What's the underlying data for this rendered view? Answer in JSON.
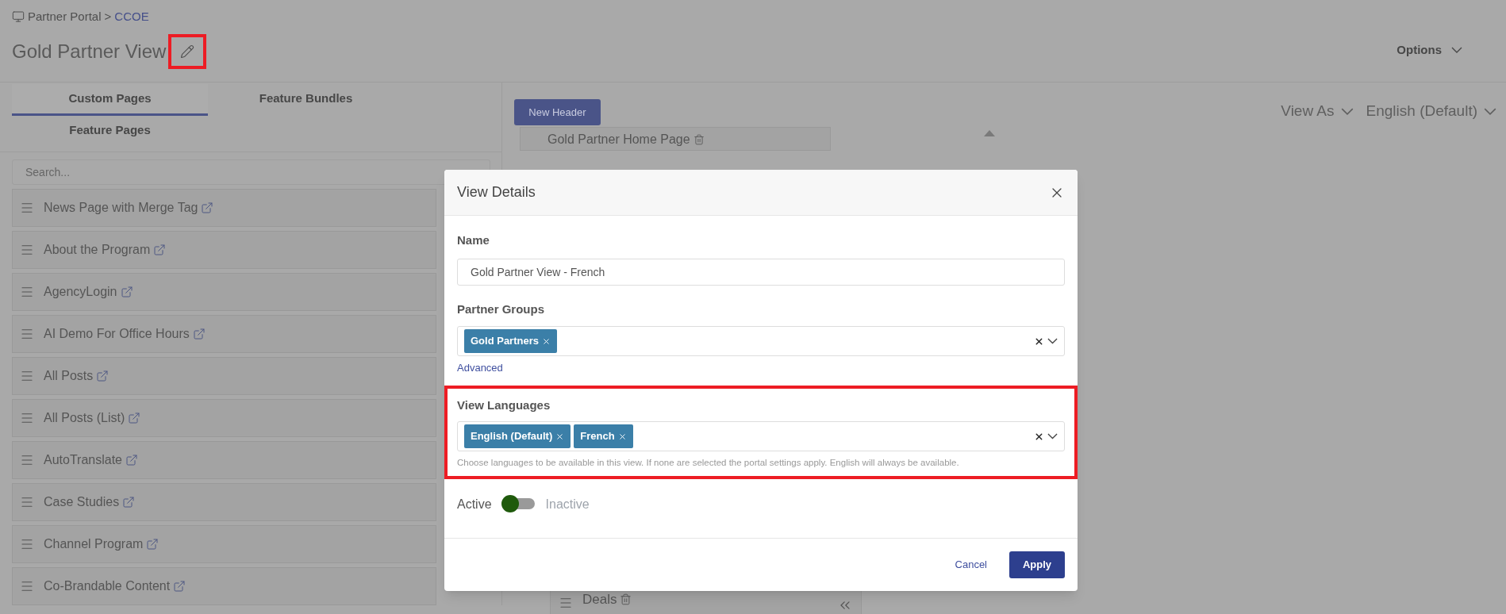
{
  "breadcrumb": {
    "root": "Partner Portal",
    "separator": ">",
    "current": "CCOE"
  },
  "page_title": "Gold Partner View",
  "options_menu": "Options",
  "tabs": [
    {
      "label": "Custom Pages",
      "selected": true
    },
    {
      "label": "Feature Bundles",
      "selected": false
    },
    {
      "label": "Feature Pages",
      "selected": false
    }
  ],
  "search": {
    "placeholder": "Search..."
  },
  "pages": [
    "News Page with Merge Tag",
    "About the Program",
    "AgencyLogin",
    "AI Demo For Office Hours",
    "All Posts",
    "All Posts (List)",
    "AutoTranslate",
    "Case Studies",
    "Channel Program",
    "Co-Brandable Content"
  ],
  "new_header_button": "New Header",
  "view_as_menu": "View As",
  "language_menu": "English (Default)",
  "canvas": {
    "header_item": "Gold Partner Home Page",
    "footer_item": "Deals"
  },
  "dialog": {
    "title": "View Details",
    "name_label": "Name",
    "name_value": "Gold Partner View - French",
    "groups_label": "Partner Groups",
    "groups": [
      "Gold Partners"
    ],
    "advanced_link": "Advanced",
    "languages_label": "View Languages",
    "languages": [
      "English (Default)",
      "French"
    ],
    "languages_help": "Choose languages to be available in this view. If none are selected the portal settings apply. English will always be available.",
    "status": {
      "on_label": "Active",
      "off_label": "Inactive",
      "active": true
    },
    "cancel": "Cancel",
    "apply": "Apply"
  }
}
